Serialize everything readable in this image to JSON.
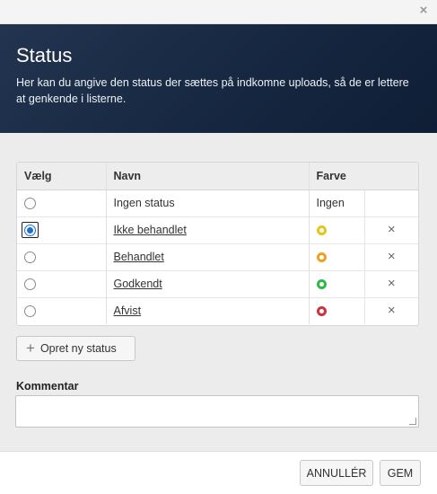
{
  "dialog": {
    "close_glyph": "×"
  },
  "header": {
    "title": "Status",
    "description": "Her kan du angive den status der sættes på indkomne uploads, så de er lettere at genkende i listerne."
  },
  "table": {
    "columns": {
      "select": "Vælg",
      "name": "Navn",
      "color": "Farve"
    },
    "rows": [
      {
        "name": "Ingen status",
        "color_label": "Ingen",
        "color": null,
        "selected": false,
        "deletable": false
      },
      {
        "name": "Ikke behandlet",
        "color": "#e8c419",
        "selected": true,
        "deletable": true
      },
      {
        "name": "Behandlet",
        "color": "#f0a021",
        "selected": false,
        "deletable": true
      },
      {
        "name": "Godkendt",
        "color": "#2fb84a",
        "selected": false,
        "deletable": true
      },
      {
        "name": "Afvist",
        "color": "#c9343d",
        "selected": false,
        "deletable": true
      }
    ],
    "delete_glyph": "×"
  },
  "new_status": {
    "icon": "plus-icon",
    "label": "Opret ny status"
  },
  "comment": {
    "label": "Kommentar",
    "value": ""
  },
  "footer": {
    "cancel_label": "ANNULLÉR",
    "save_label": "GEM"
  }
}
